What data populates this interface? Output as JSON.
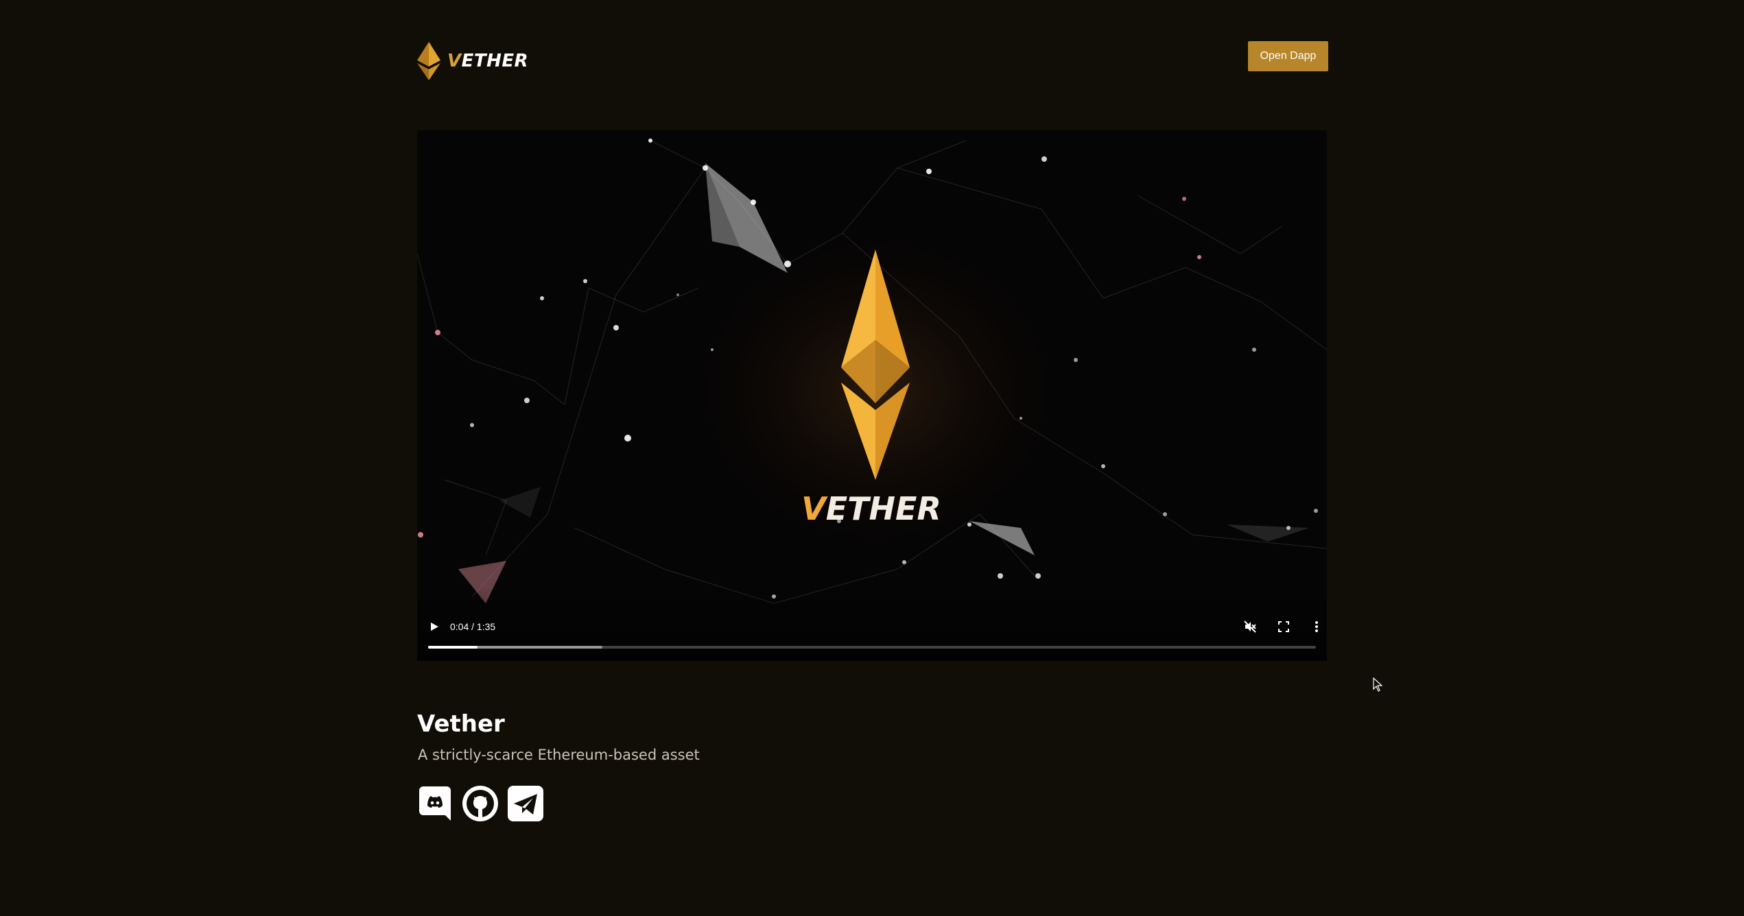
{
  "header": {
    "logo_text_accent": "V",
    "logo_text_rest": "ETHER",
    "open_dapp_label": "Open Dapp"
  },
  "video": {
    "overlay_text_accent": "V",
    "overlay_text_rest": "ETHER",
    "current_time": "0:04",
    "duration": "1:35",
    "time_display": "0:04 / 1:35",
    "played_fraction": 0.056,
    "buffered_fraction": 0.196,
    "muted": true
  },
  "main": {
    "title": "Vether",
    "subtitle": "A strictly-scarce Ethereum-based asset"
  },
  "socials": [
    {
      "name": "discord-icon"
    },
    {
      "name": "github-icon"
    },
    {
      "name": "telegram-icon"
    }
  ],
  "colors": {
    "background": "#110e07",
    "accent": "#b8862a",
    "gold": "#f2a73b"
  }
}
